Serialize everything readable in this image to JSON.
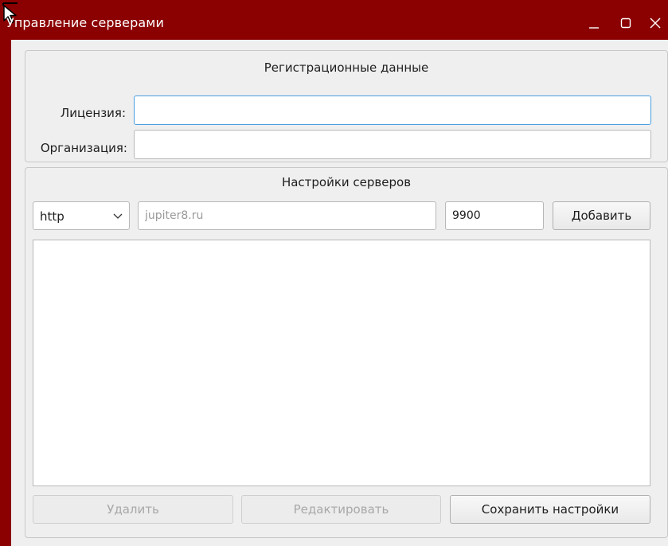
{
  "window": {
    "title": "Управление серверами",
    "accent_color": "#8b0000",
    "controls": [
      "minimize-icon",
      "maximize-icon",
      "close-icon"
    ]
  },
  "registration": {
    "title": "Регистрационные данные",
    "license_label": "Лицензия:",
    "license_value": "",
    "org_label": "Организация:",
    "org_value": ""
  },
  "servers": {
    "title": "Настройки серверов",
    "protocol_selected": "http",
    "host_placeholder": "jupiter8.ru",
    "host_value": "",
    "port_value": "9900",
    "add_label": "Добавить",
    "list_items": []
  },
  "actions": {
    "delete_label": "Удалить",
    "edit_label": "Редактировать",
    "save_label": "Сохранить настройки"
  }
}
